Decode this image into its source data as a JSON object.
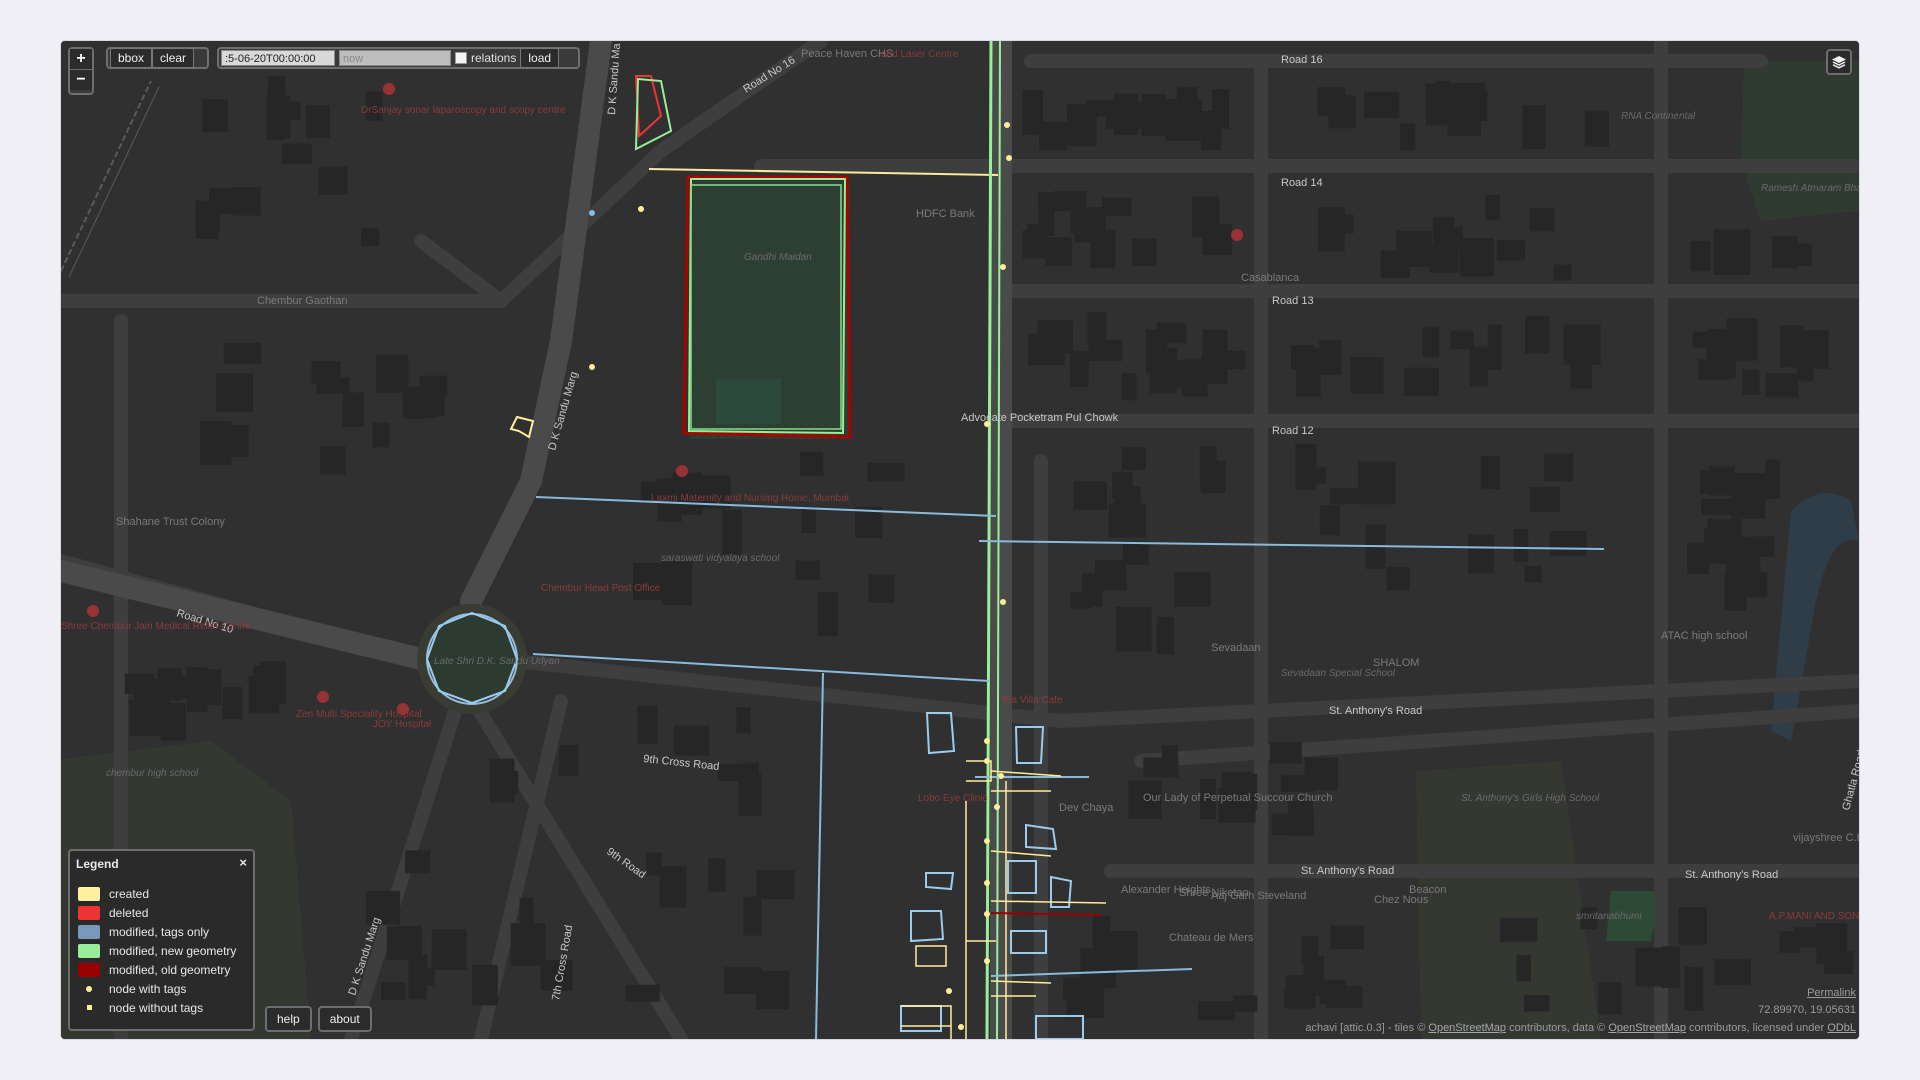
{
  "toolbar": {
    "zoom_in": "+",
    "zoom_out": "−",
    "bbox_label": "bbox",
    "clear_label": "clear",
    "date_from_value": ":5-06-20T00:00:00",
    "date_to_placeholder": "now",
    "relations_label": "relations",
    "relations_checked": false,
    "load_label": "load"
  },
  "legend": {
    "title": "Legend",
    "close": "×",
    "items": [
      {
        "label": "created",
        "color": "#fff0a0"
      },
      {
        "label": "deleted",
        "color": "#ee3333"
      },
      {
        "label": "modified, tags only",
        "color": "#7799bb"
      },
      {
        "label": "modified, new geometry",
        "color": "#99ee99"
      },
      {
        "label": "modified, old geometry",
        "color": "#990000"
      },
      {
        "label": "node with tags",
        "icon": "round-dot"
      },
      {
        "label": "node without tags",
        "icon": "square-dot"
      }
    ]
  },
  "bottom_buttons": {
    "help": "help",
    "about": "about"
  },
  "footer": {
    "permalink": "Permalink",
    "coords": "72.89970, 19.05631",
    "attribution_prefix": "achavi [attic.0.3]  -  tiles ©",
    "osm_link": "OpenStreetMap",
    "attribution_mid": "contributors, data ©",
    "osm_link2": "OpenStreetMap",
    "attribution_suffix": "contributors, licensed under",
    "odbl": "ODbL"
  },
  "map_labels": {
    "road16": "Road 16",
    "road14": "Road 14",
    "road13": "Road 13",
    "road12": "Road 12",
    "road10": "Road No 10",
    "road_no16": "Road No 16",
    "dk_sandu_top": "D K Sandu Ma",
    "dk_sandu_mid": "D K Sandu Marg",
    "dk_sandu_low": "D K Sandu Marg",
    "chembur_gaothan": "Chembur Gaothan",
    "gandhi_maidan": "Gandhi Maidan",
    "rna_continental": "RNA Continental",
    "ramesh": "Ramesh Atmaram Bhau Ground",
    "casablanca": "Casablanca",
    "hdfc": "HDFC Bank",
    "peace_haven": "Peace Haven CHS",
    "laser_centre": "and Laser Centre",
    "drsanjay": "DrSanjay sonar laparoscopy and scopy centre",
    "adv": "Advocate Pocketram Pul Chowk",
    "shahane": "Shahane Trust Colony",
    "chembur_post": "Chembur Head Post Office",
    "saraswati": "saraswati vidyalaya school",
    "laxmi": "Laxmi Maternity and Nursing Home, Mumbai",
    "circle": "Late Shri D.K. Sandu Udyan",
    "shree_chembur": "Shree Chembur Jain Medical Relief Centre",
    "zen": "Zen Multi Speciality Hospital",
    "joy": "JOY Hospital",
    "chembur_high": "chembur high school",
    "ninth_cross": "9th Cross Road",
    "ninth_road": "9th Road",
    "seventh_cross": "7th Cross Road",
    "sevadaan": "Sevadaan",
    "sevadaan_school": "Sevadaan Special School",
    "shalom": "SHALOM",
    "atac": "ATAC high school",
    "st_anthony_road": "St. Anthony's Road",
    "st_anthony_road2": "St. Anthony's Road",
    "st_anthony_road3": "St. Anthony's Road",
    "st_anthony_school": "St. Anthony's Girls High School",
    "our_lady": "Our Lady of Perpetual Succour Church",
    "vijayshree": "vijayshree C.H.S.",
    "ghatla": "Ghatla Road",
    "lobo": "Lobo Eye Clinic",
    "dev_chaya": "Dev Chaya",
    "tea_villa": "Tea Villa Cafe",
    "alexander": "Alexander Heights",
    "shree_niketan": "Shree Niketan",
    "aaj_garh": "Aaj Garh Steveland",
    "chez_nous": "Chez Nous",
    "beacon": "Beacon",
    "chateau": "Chateau de Mers",
    "apmani": "A.P.MANI AND SONS",
    "smritanabhumi": "smritanabhumi"
  }
}
